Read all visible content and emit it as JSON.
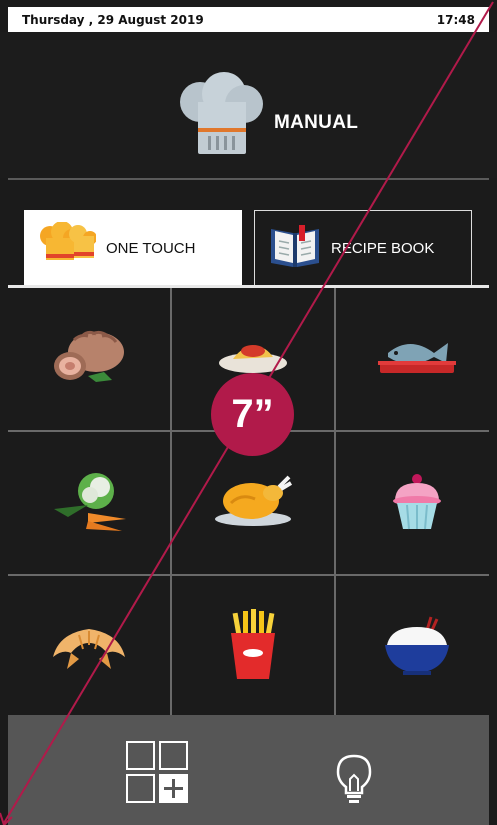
{
  "status": {
    "date": "Thursday , 29 August 2019",
    "time": "17:48"
  },
  "manual": {
    "label": "MANUAL",
    "icon": "chef-hat-icon"
  },
  "tabs": [
    {
      "label": "ONE TOUCH",
      "icon": "chef-hats-icon",
      "active": true
    },
    {
      "label": "RECIPE BOOK",
      "icon": "recipe-book-icon",
      "active": false
    }
  ],
  "grid_items": [
    {
      "icon": "roast-meat-icon"
    },
    {
      "icon": "pasta-icon"
    },
    {
      "icon": "fish-icon"
    },
    {
      "icon": "vegetables-icon"
    },
    {
      "icon": "roast-chicken-icon"
    },
    {
      "icon": "cupcake-icon"
    },
    {
      "icon": "croissant-icon"
    },
    {
      "icon": "french-fries-icon"
    },
    {
      "icon": "rice-bowl-icon"
    }
  ],
  "bottom": {
    "add_icon": "add-grid-icon",
    "tip_icon": "lightbulb-icon"
  },
  "badge": {
    "text": "7”"
  },
  "colors": {
    "accent": "#b11a4a",
    "background": "#1b1b1b",
    "bottom_bar": "#565656"
  }
}
